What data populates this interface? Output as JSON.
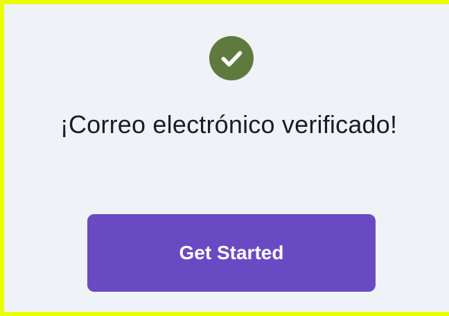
{
  "colors": {
    "frame_border": "#eaff00",
    "background": "#eff2f6",
    "success": "#5f7a3f",
    "primary": "#6a4ac3",
    "text": "#1a1d22"
  },
  "status": {
    "icon": "check-circle-icon",
    "title": "¡Correo electrónico verificado!"
  },
  "actions": {
    "primary_label": "Get Started"
  }
}
